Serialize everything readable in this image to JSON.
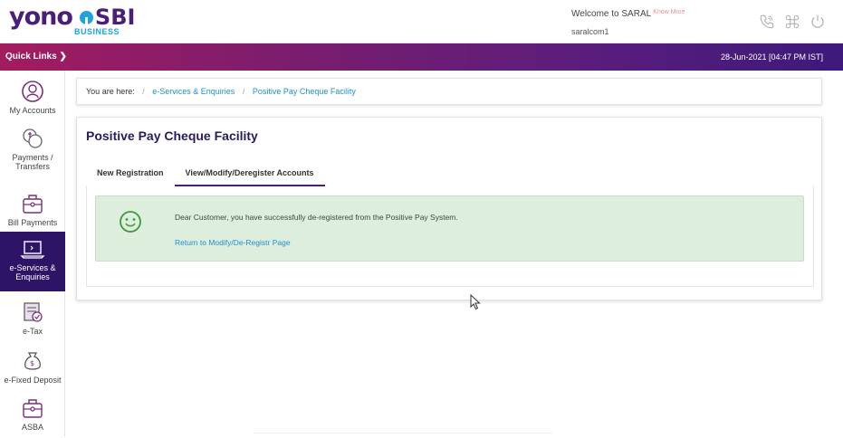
{
  "header": {
    "logo_main": "yono",
    "logo_sbi": "SBI",
    "logo_sub": "BUSINESS",
    "welcome": "Welcome to SARAL",
    "know_more": "Know More",
    "username": "saralcom1",
    "icons": [
      "phone-icon",
      "command-icon",
      "power-icon"
    ]
  },
  "bar": {
    "quick_links": "Quick Links ❯",
    "datetime": "28-Jun-2021 [04:47 PM IST]"
  },
  "sidebar": {
    "items": [
      {
        "label": "My Accounts",
        "icon": "account-icon"
      },
      {
        "label": "Payments /",
        "label2": "Transfers",
        "icon": "payments-icon"
      },
      {
        "label": "Bill Payments",
        "icon": "bill-icon"
      },
      {
        "label": "e-Services &",
        "label2": "Enquiries",
        "icon": "laptop-icon"
      },
      {
        "label": "e-Tax",
        "icon": "tax-icon"
      },
      {
        "label": "e-Fixed Deposit",
        "icon": "deposit-icon"
      },
      {
        "label": "ASBA",
        "icon": "asba-icon"
      }
    ]
  },
  "breadcrumb": {
    "prefix": "You are here:",
    "sep": "/",
    "items": [
      "e-Services & Enquiries",
      "Positive Pay Cheque Facility"
    ]
  },
  "main": {
    "title": "Positive Pay Cheque Facility",
    "tabs": [
      {
        "label": "New Registration"
      },
      {
        "label": "View/Modify/Deregister Accounts"
      }
    ],
    "message": "Dear Customer, you have successfully de-registered from the Positive Pay System.",
    "return_link": "Return to Modify/De-Registr Page"
  },
  "colors": {
    "brand_purple": "#4b1e78",
    "accent_blue": "#1fa3dc",
    "success_bg": "#ddeedd",
    "active_sidebar": "#2d1467"
  }
}
